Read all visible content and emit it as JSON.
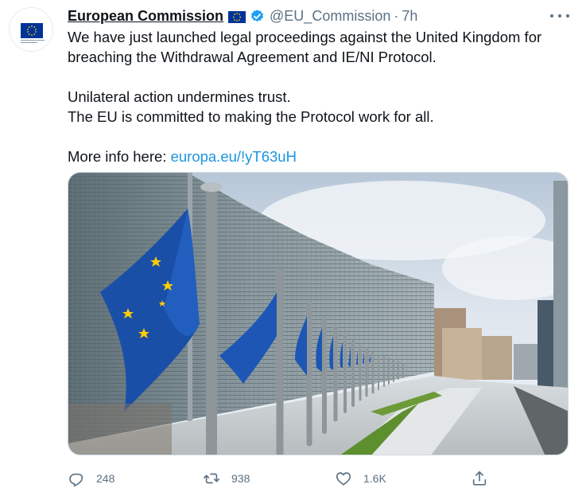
{
  "author": {
    "name": "European Commission",
    "handle": "@EU_Commission",
    "separator": "·",
    "time": "7h",
    "avatar_icon": "eu-commission-logo",
    "flag_icon": "eu-flag",
    "verified_icon": "verified-badge"
  },
  "tweet": {
    "line1": "We have just launched legal proceedings against the United Kingdom for breaching the Withdrawal Agreement and IE/NI Protocol.",
    "line2": "Unilateral action undermines trust.",
    "line3": "The EU is committed to making the Protocol work for all.",
    "more_prefix": "More info here: ",
    "link": "europa.eu/!yT63uH"
  },
  "media": {
    "alt_icon": "berlaymont-building-with-eu-flags-photo"
  },
  "actions": {
    "reply_count": "248",
    "retweet_count": "938",
    "like_count": "1.6K"
  },
  "colors": {
    "link": "#1b95e0",
    "secondary_text": "#5b7083",
    "verified": "#1da1f2",
    "eu_blue": "#003399",
    "eu_star": "#ffcc00"
  }
}
